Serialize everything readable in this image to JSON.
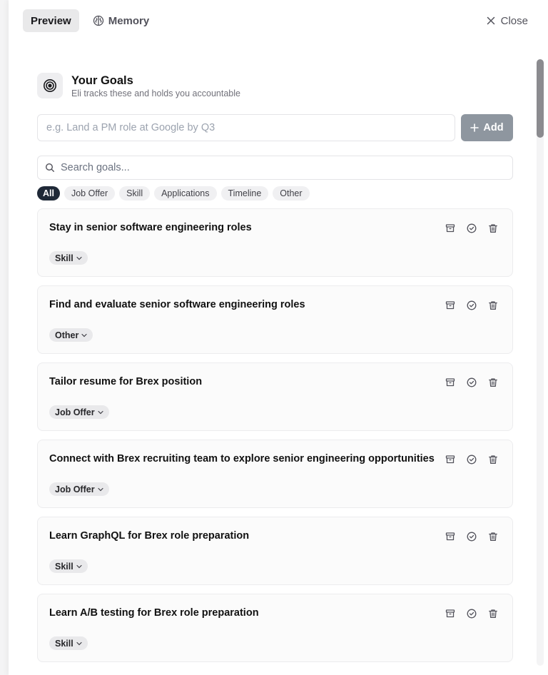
{
  "tabs": {
    "preview": "Preview",
    "memory": "Memory",
    "close": "Close"
  },
  "header": {
    "title": "Your Goals",
    "subtitle": "Eli tracks these and holds you accountable"
  },
  "add_goal": {
    "placeholder": "e.g. Land a PM role at Google by Q3",
    "button_label": "Add"
  },
  "search": {
    "placeholder": "Search goals..."
  },
  "filters": [
    "All",
    "Job Offer",
    "Skill",
    "Applications",
    "Timeline",
    "Other"
  ],
  "active_filter": "All",
  "goals": [
    {
      "title": "Stay in senior software engineering roles",
      "category": "Skill"
    },
    {
      "title": "Find and evaluate senior software engineering roles",
      "category": "Other"
    },
    {
      "title": "Tailor resume for Brex position",
      "category": "Job Offer"
    },
    {
      "title": "Connect with Brex recruiting team to explore senior engineering opportunities",
      "category": "Job Offer"
    },
    {
      "title": "Learn GraphQL for Brex role preparation",
      "category": "Skill"
    },
    {
      "title": "Learn A/B testing for Brex role preparation",
      "category": "Skill"
    }
  ],
  "icons": {
    "memory": "brain-icon",
    "close": "close-icon",
    "header": "target-icon",
    "add": "plus-icon",
    "search": "search-icon",
    "archive": "archive-icon",
    "complete": "check-circle-icon",
    "delete": "trash-icon",
    "tag_dropdown": "chevron-down-icon"
  },
  "colors": {
    "add_button": "#8e969f",
    "active_chip": "#1f2937"
  }
}
